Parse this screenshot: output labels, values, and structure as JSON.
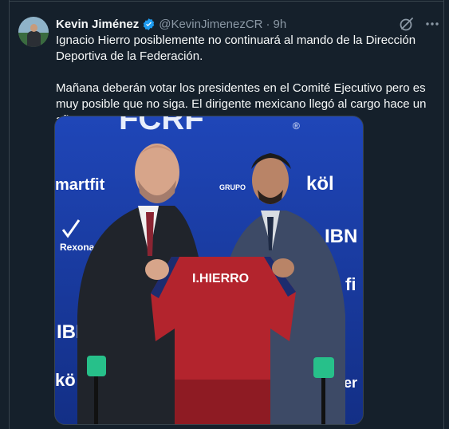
{
  "tweet": {
    "author_name": "Kevin Jiménez",
    "author_handle": "@KevinJimenezCR",
    "separator": "·",
    "time": "9h",
    "paragraphs": [
      "Ignacio Hierro posiblemente no continuará al mando de la Dirección Deportiva de la Federación.",
      "Mañana deberán votar los presidentes en el Comité Ejecutivo pero es muy posible que no siga. El dirigente mexicano llegó al cargo hace un año."
    ],
    "flag_emoji": "costa-rica-flag"
  },
  "icons": {
    "verified": "verified-badge-icon",
    "grok": "grok-icon",
    "more": "more-icon"
  },
  "photo": {
    "backdrop_top": "FCRF",
    "backdrop_registered": "®",
    "sponsor_left_1": "martfit",
    "sponsor_left_2": "Rexona",
    "sponsor_left_3": "IBN",
    "sponsor_left_4": "kö",
    "sponsor_mid": "GRUPO",
    "sponsor_right_1": "köl",
    "sponsor_right_2": "IBN",
    "sponsor_right_3": "fi",
    "sponsor_right_4": "ycer",
    "jersey_text": "I.HIERRO"
  },
  "colors": {
    "background": "#15202b",
    "text_primary": "#f7f9f9",
    "text_secondary": "#8b98a5",
    "verified": "#1d9bf0",
    "backdrop": "#1a3aa0",
    "jersey_red": "#b3242d"
  }
}
